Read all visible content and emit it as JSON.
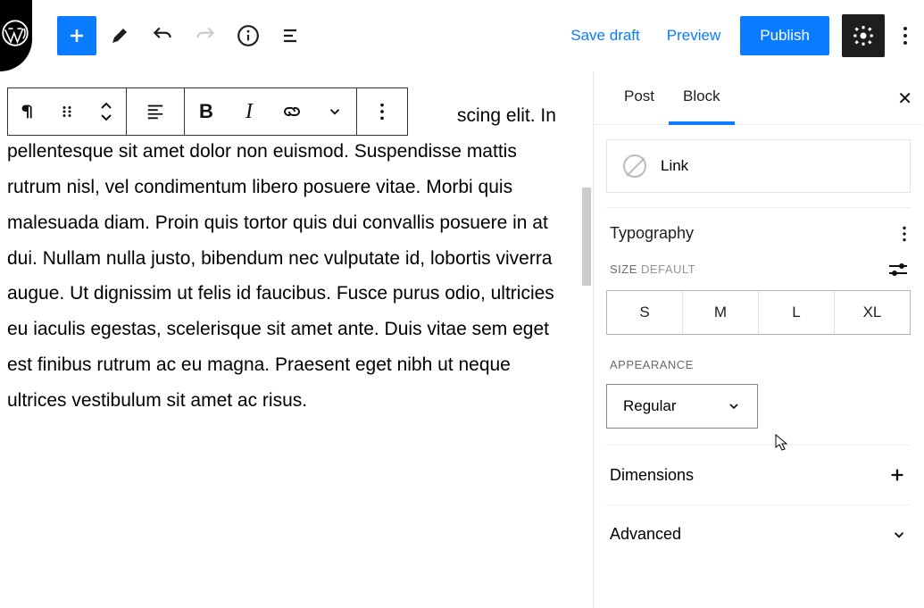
{
  "toolbar": {
    "save_draft": "Save draft",
    "preview": "Preview",
    "publish": "Publish"
  },
  "sidebar": {
    "tabs": {
      "post": "Post",
      "block": "Block"
    },
    "link": {
      "label": "Link"
    },
    "typography": {
      "title": "Typography",
      "size_label": "SIZE",
      "size_note": "DEFAULT",
      "sizes": {
        "s": "S",
        "m": "M",
        "l": "L",
        "xl": "XL"
      },
      "appearance_label": "APPEARANCE",
      "appearance_value": "Regular"
    },
    "dimensions": "Dimensions",
    "advanced": "Advanced"
  },
  "content": {
    "paragraph": "scing elit. In pellentesque sit amet dolor non euismod. Suspendisse mattis rutrum nisl, vel condimentum libero posuere vitae. Morbi quis malesuada diam. Proin quis tortor quis dui convallis posuere in at dui. Nullam nulla justo, bibendum nec vulputate id, lobortis viverra augue. Ut dignissim ut felis id faucibus. Fusce purus odio, ultricies eu iaculis egestas, scelerisque sit amet ante. Duis vitae sem eget est finibus rutrum ac eu magna. Praesent eget nibh ut neque ultrices vestibulum sit amet ac risus."
  }
}
